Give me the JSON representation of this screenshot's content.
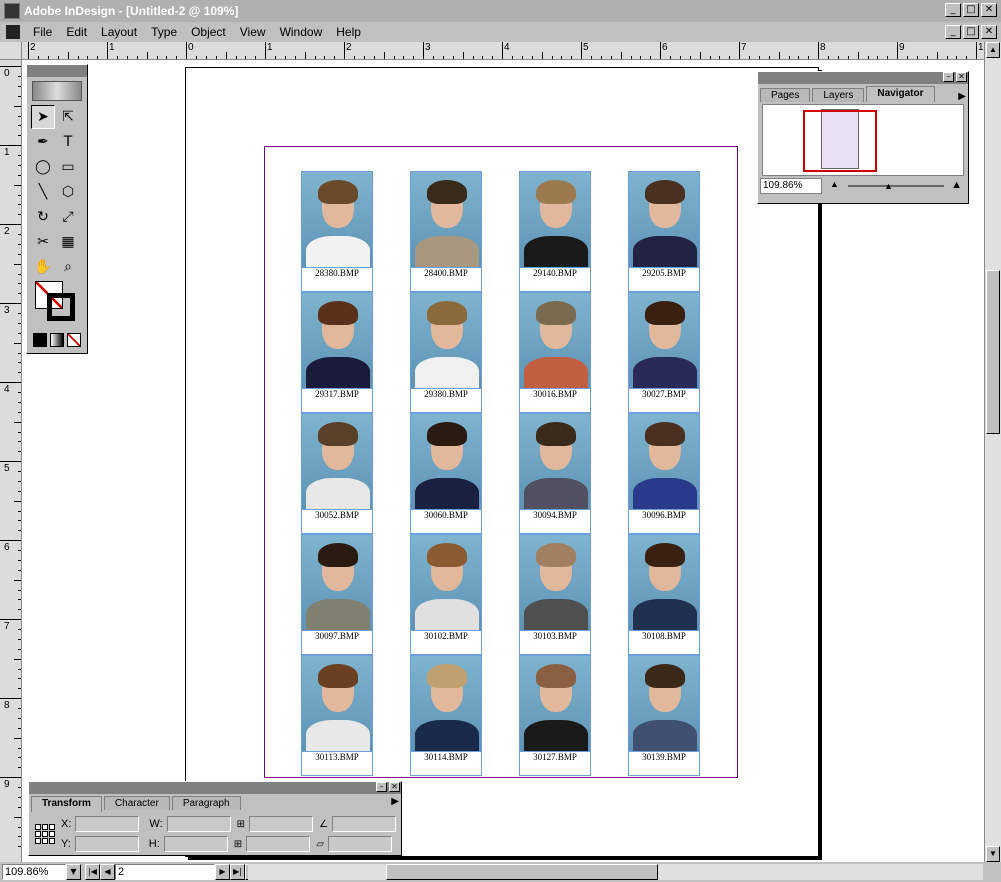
{
  "window": {
    "title": "Adobe InDesign - [Untitled-2 @ 109%]",
    "buttons": {
      "minimize": "_",
      "maximize": "□",
      "close": "✕"
    }
  },
  "menu": [
    {
      "label": "File"
    },
    {
      "label": "Edit"
    },
    {
      "label": "Layout"
    },
    {
      "label": "Type"
    },
    {
      "label": "Object"
    },
    {
      "label": "View"
    },
    {
      "label": "Window"
    },
    {
      "label": "Help"
    }
  ],
  "ruler": {
    "horizontal": [
      "2",
      "1",
      "0",
      "1",
      "2",
      "3",
      "4",
      "5",
      "6",
      "7",
      "8",
      "9",
      "10"
    ],
    "vertical": [
      "0",
      "1",
      "2",
      "3",
      "4",
      "5",
      "6",
      "7",
      "8",
      "9"
    ]
  },
  "photos": [
    {
      "caption": "28380.BMP",
      "hair": "#6b4a2a",
      "shirt": "#f2f2f2"
    },
    {
      "caption": "28400.BMP",
      "hair": "#3a2a1a",
      "shirt": "#a89880"
    },
    {
      "caption": "29140.BMP",
      "hair": "#9b7a50",
      "shirt": "#1a1a1a"
    },
    {
      "caption": "29205.BMP",
      "hair": "#4a3020",
      "shirt": "#222244"
    },
    {
      "caption": "29317.BMP",
      "hair": "#5a3018",
      "shirt": "#1a1a3a"
    },
    {
      "caption": "29380.BMP",
      "hair": "#8a6a3a",
      "shirt": "#f0f0f0"
    },
    {
      "caption": "30016.BMP",
      "hair": "#7a6a50",
      "shirt": "#c06040"
    },
    {
      "caption": "30027.BMP",
      "hair": "#3a2010",
      "shirt": "#2a2a5a"
    },
    {
      "caption": "30052.BMP",
      "hair": "#5a4028",
      "shirt": "#e8e8e8"
    },
    {
      "caption": "30060.BMP",
      "hair": "#2a1a10",
      "shirt": "#1a2040"
    },
    {
      "caption": "30094.BMP",
      "hair": "#3a2a1a",
      "shirt": "#505060"
    },
    {
      "caption": "30096.BMP",
      "hair": "#4a3020",
      "shirt": "#2a3a8a"
    },
    {
      "caption": "30097.BMP",
      "hair": "#2a1a10",
      "shirt": "#808070"
    },
    {
      "caption": "30102.BMP",
      "hair": "#8a5a30",
      "shirt": "#e0e0e0"
    },
    {
      "caption": "30103.BMP",
      "hair": "#a08060",
      "shirt": "#505050"
    },
    {
      "caption": "30108.BMP",
      "hair": "#3a2010",
      "shirt": "#203050"
    },
    {
      "caption": "30113.BMP",
      "hair": "#6a4020",
      "shirt": "#e8e8e8"
    },
    {
      "caption": "30114.BMP",
      "hair": "#c0a070",
      "shirt": "#1a2a4a"
    },
    {
      "caption": "30127.BMP",
      "hair": "#8a6040",
      "shirt": "#1a1a1a"
    },
    {
      "caption": "30139.BMP",
      "hair": "#3a2818",
      "shirt": "#405070"
    }
  ],
  "navigator": {
    "tabs": [
      {
        "label": "Pages"
      },
      {
        "label": "Layers"
      },
      {
        "label": "Navigator"
      }
    ],
    "zoom": "109.86%",
    "view_box_color": "#d00000"
  },
  "transform": {
    "tabs": [
      {
        "label": "Transform"
      },
      {
        "label": "Character"
      },
      {
        "label": "Paragraph"
      }
    ],
    "x_label": "X:",
    "y_label": "Y:",
    "w_label": "W:",
    "h_label": "H:"
  },
  "status": {
    "zoom": "109.86%",
    "page": "2"
  },
  "colors": {
    "frame_border": "#6aa0e0",
    "margin_guide": "#800080",
    "photo_bg": "#7fb4cf"
  }
}
